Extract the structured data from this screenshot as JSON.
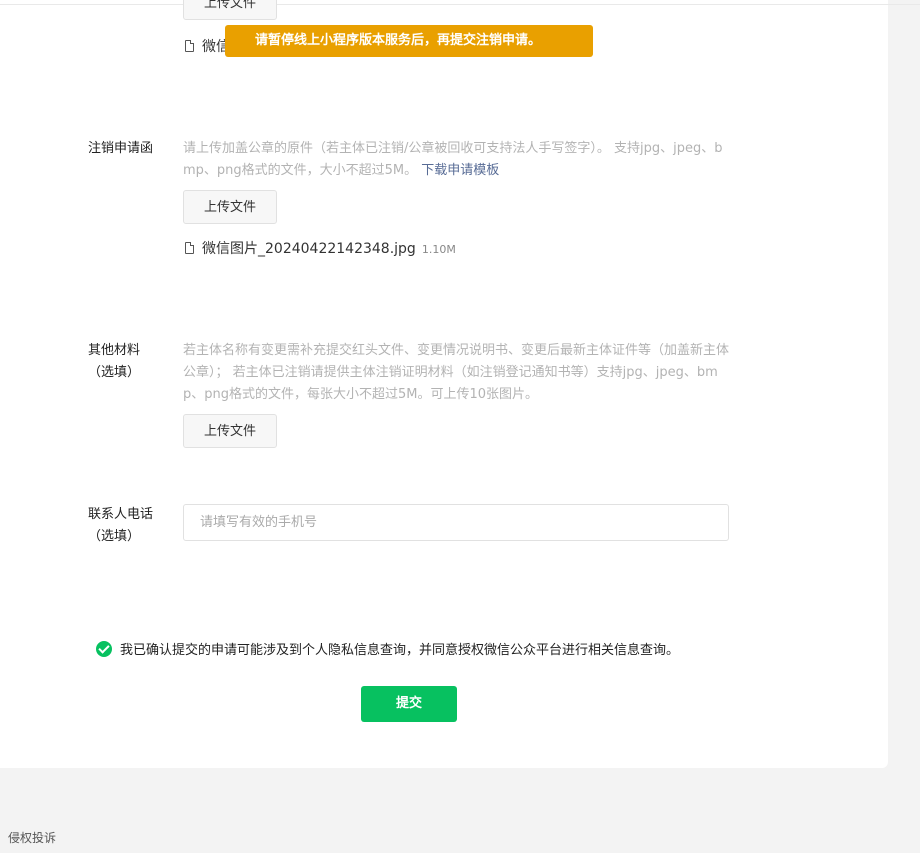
{
  "toast": {
    "text": "请暂停线上小程序版本服务后，再提交注销申请。"
  },
  "top_partial": {
    "upload_label": "上传文件",
    "file_name_partial": "微信"
  },
  "deregistration_letter": {
    "label": "注销申请函",
    "description": "请上传加盖公章的原件（若主体已注销/公章被回收可支持法人手写签字）。 支持jpg、jpeg、bmp、png格式的文件，大小不超过5M。",
    "template_link": "下载申请模板",
    "upload_label": "上传文件",
    "file_name": "微信图片_20240422142348.jpg",
    "file_size": "1.10M"
  },
  "other_materials": {
    "label": "其他材料（选填）",
    "description": "若主体名称有变更需补充提交红头文件、变更情况说明书、变更后最新主体证件等（加盖新主体公章）； 若主体已注销请提供主体注销证明材料（如注销登记通知书等）支持jpg、jpeg、bmp、png格式的文件，每张大小不超过5M。可上传10张图片。",
    "upload_label": "上传文件"
  },
  "contact_phone": {
    "label": "联系人电话（选填）",
    "placeholder": "请填写有效的手机号",
    "value": ""
  },
  "agreement": {
    "checked": true,
    "text": "我已确认提交的申请可能涉及到个人隐私信息查询，并同意授权微信公众平台进行相关信息查询。"
  },
  "submit_label": "提交",
  "footer": {
    "report_link": "侵权投诉"
  },
  "colors": {
    "primary": "#07c160",
    "warning": "#e9a000",
    "link": "#576b95"
  }
}
